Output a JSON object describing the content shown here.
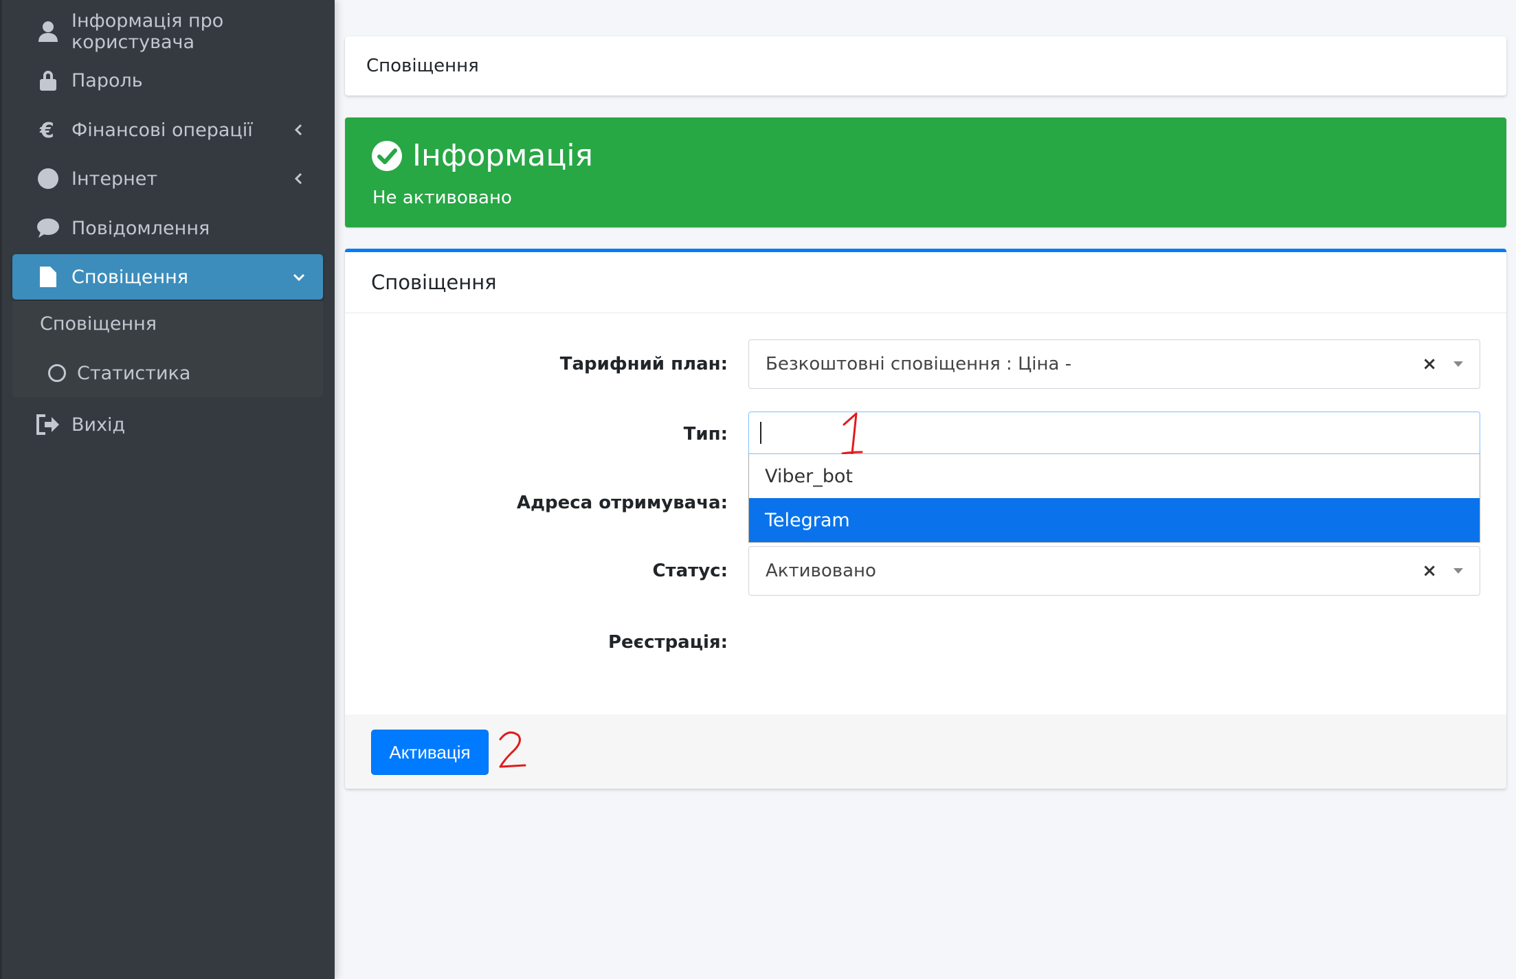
{
  "sidebar": {
    "items": [
      {
        "label": "Інформація про користувача",
        "icon": "user-icon"
      },
      {
        "label": "Пароль",
        "icon": "lock-icon"
      },
      {
        "label": "Фінансові операції",
        "icon": "euro-icon"
      },
      {
        "label": "Інтернет",
        "icon": "circle-icon"
      },
      {
        "label": "Повідомлення",
        "icon": "comment-icon"
      },
      {
        "label": "Сповіщення",
        "icon": "file-icon"
      },
      {
        "label": "Вихід",
        "icon": "sign-out-icon"
      }
    ],
    "submenu": [
      {
        "label": "Сповіщення"
      },
      {
        "label": "Статистика",
        "icon": "circle-outline-icon"
      }
    ]
  },
  "header": {
    "title": "Сповіщення"
  },
  "alert": {
    "title": "Інформація",
    "message": "Не активовано",
    "color": "#28a745"
  },
  "form": {
    "card_title": "Сповіщення",
    "accent": "#007bff",
    "fields": {
      "tariff_label": "Тарифний план:",
      "tariff_value": "Безкоштовні сповіщення : Ціна -",
      "type_label": "Тип:",
      "recipient_label": "Адреса отримувача:",
      "status_label": "Статус:",
      "status_value": "Активовано",
      "registration_label": "Реєстрація:"
    },
    "type_options": [
      "Viber_bot",
      "Telegram"
    ],
    "type_selected": "Telegram",
    "submit_label": "Активація"
  },
  "annotations": [
    "1",
    "2"
  ]
}
